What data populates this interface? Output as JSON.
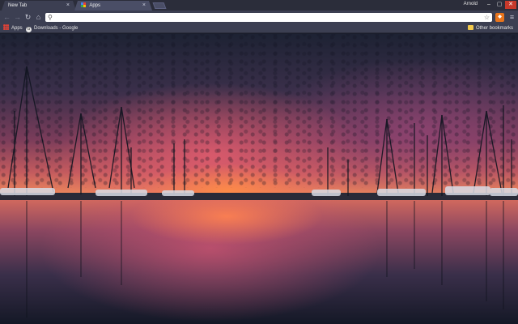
{
  "tabs": [
    {
      "label": "New Tab",
      "active": true
    },
    {
      "label": "Apps",
      "active": false
    }
  ],
  "profile": {
    "name": "Arnold"
  },
  "window_controls": {
    "minimize": "–",
    "maximize": "▢",
    "close": "✕"
  },
  "toolbar": {
    "back_icon": "←",
    "forward_icon": "→",
    "reload_icon": "↻",
    "home_icon": "⌂",
    "omnibox_value": "",
    "omnibox_placeholder": "",
    "star_icon": "☆",
    "extension_icon": "🦊",
    "menu_icon": "≡"
  },
  "bookmarks": {
    "items": [
      {
        "label": "Apps"
      },
      {
        "label": "Downloads - Google"
      }
    ],
    "other_label": "Other bookmarks"
  },
  "colors": {
    "tab_active": "#3c3f52",
    "tab_inactive": "#4a4e66",
    "toolbar": "#3c3f52",
    "close_button": "#c7392b"
  }
}
